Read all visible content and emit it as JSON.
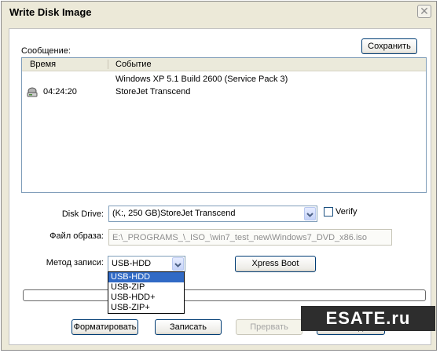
{
  "window": {
    "title": "Write Disk Image",
    "close_glyph": "✕"
  },
  "log": {
    "label": "Сообщение:",
    "save_label": "Сохранить",
    "columns": [
      "Время",
      "Событие"
    ],
    "entries": [
      {
        "time": "",
        "event": "Windows XP 5.1 Build 2600 (Service Pack 3)"
      },
      {
        "time": "04:24:20",
        "event": "StoreJet Transcend",
        "icon": "disk-drive-icon"
      }
    ]
  },
  "disk_drive": {
    "label": "Disk Drive:",
    "value": "(K:, 250 GB)StoreJet Transcend",
    "verify_label": "Verify",
    "verify_checked": false
  },
  "image_file": {
    "label": "Файл образа:",
    "value": "E:\\_PROGRAMS_\\_ISO_\\win7_test_new\\Windows7_DVD_x86.iso"
  },
  "write_method": {
    "label": "Метод записи:",
    "value": "USB-HDD",
    "options": [
      "USB-HDD",
      "USB-ZIP",
      "USB-HDD+",
      "USB-ZIP+"
    ],
    "selected_index": 0
  },
  "xpress_boot_label": "Xpress Boot",
  "progress": 0,
  "buttons": {
    "format": "Форматировать",
    "write": "Записать",
    "abort": "Прервать",
    "back": "Назад"
  },
  "watermark": "ESATE.ru",
  "colors": {
    "window_bg": "#ece9d8",
    "selection": "#316ac5",
    "button_border": "#003c74",
    "watermark_bg": "#2d2d2d"
  }
}
